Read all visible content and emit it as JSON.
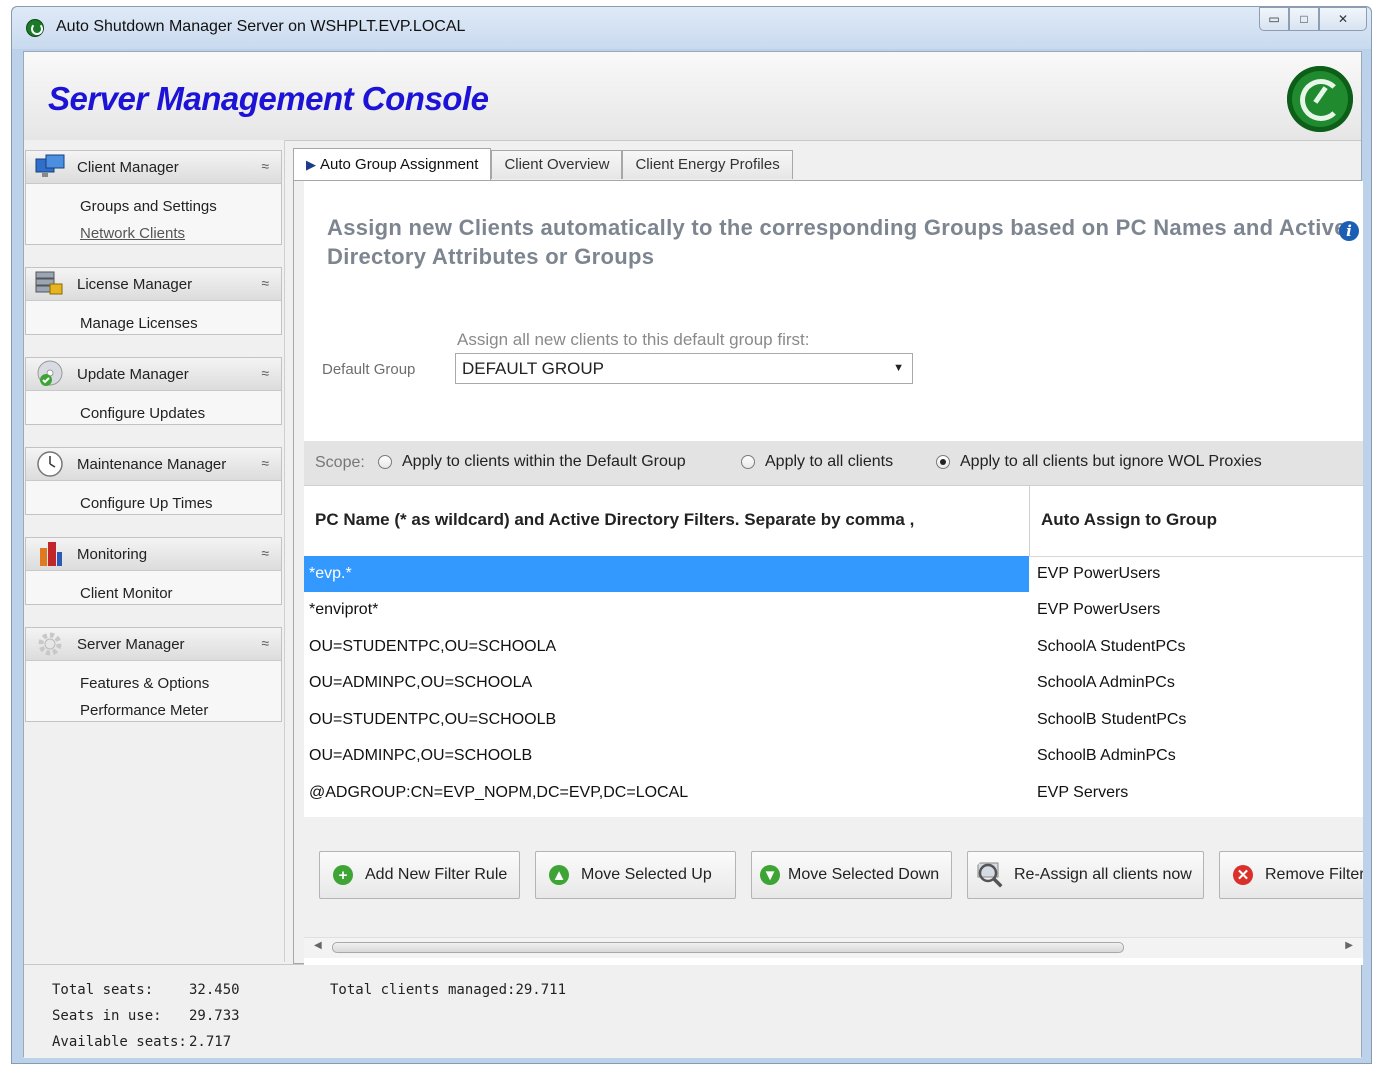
{
  "window": {
    "title": "Auto Shutdown Manager Server on WSHPLT.EVP.LOCAL",
    "minimize_glyph": "▭",
    "maximize_glyph": "□",
    "close_glyph": "✕"
  },
  "header": {
    "title": "Server Management Console",
    "logo_icon": "power-clock-icon"
  },
  "sidebar": {
    "sections": [
      {
        "title": "Client Manager",
        "icon": "monitors-icon",
        "items": [
          "Groups and Settings",
          "Network Clients"
        ]
      },
      {
        "title": "License Manager",
        "icon": "license-server-icon",
        "items": [
          "Manage Licenses"
        ]
      },
      {
        "title": "Update  Manager",
        "icon": "update-disc-icon",
        "items": [
          "Configure Updates"
        ]
      },
      {
        "title": "Maintenance Manager",
        "icon": "clock-icon",
        "items": [
          "Configure Up Times"
        ]
      },
      {
        "title": "Monitoring",
        "icon": "bar-chart-icon",
        "items": [
          "Client Monitor"
        ]
      },
      {
        "title": "Server Manager",
        "icon": "gear-icon",
        "items": [
          "Features & Options",
          "Performance Meter"
        ]
      }
    ],
    "collapse_glyph": "≈"
  },
  "tabs": [
    {
      "label": "Auto Group Assignment",
      "active": true
    },
    {
      "label": "Client Overview",
      "active": false
    },
    {
      "label": "Client Energy Profiles",
      "active": false
    }
  ],
  "panel": {
    "headline": "Assign new Clients automatically to the corresponding Groups based on PC Names and Active Directory Attributes or Groups",
    "info_icon": "i",
    "assign_label": "Assign all new clients to this default group first:",
    "default_group_label": "Default Group",
    "default_group_value": "DEFAULT GROUP",
    "scope": {
      "label": "Scope:",
      "options": [
        {
          "label": "Apply to clients within the Default Group",
          "checked": false
        },
        {
          "label": "Apply to all clients",
          "checked": false
        },
        {
          "label": "Apply to all clients but  ignore WOL Proxies",
          "checked": true
        }
      ]
    },
    "grid": {
      "columns": [
        "PC Name (* as wildcard) and Active Directory Filters. Separate by comma ,",
        "Auto Assign to Group"
      ],
      "rows": [
        {
          "filter": "*evp.*",
          "group": "EVP PowerUsers",
          "selected": true
        },
        {
          "filter": "*enviprot*",
          "group": "EVP PowerUsers",
          "selected": false
        },
        {
          "filter": "OU=STUDENTPC,OU=SCHOOLA",
          "group": "SchoolA StudentPCs",
          "selected": false
        },
        {
          "filter": "OU=ADMINPC,OU=SCHOOLA",
          "group": "SchoolA AdminPCs",
          "selected": false
        },
        {
          "filter": "OU=STUDENTPC,OU=SCHOOLB",
          "group": "SchoolB StudentPCs",
          "selected": false
        },
        {
          "filter": "OU=ADMINPC,OU=SCHOOLB",
          "group": "SchoolB AdminPCs",
          "selected": false
        },
        {
          "filter": "@ADGROUP:CN=EVP_NOPM,DC=EVP,DC=LOCAL",
          "group": "EVP Servers",
          "selected": false
        }
      ]
    },
    "buttons": {
      "add": "Add New Filter Rule",
      "up": "Move Selected Up",
      "down": "Move Selected Down",
      "reassign": "Re-Assign all clients now",
      "remove": "Remove Filter"
    }
  },
  "footer": {
    "total_seats_label": "Total seats:",
    "total_seats": "32.450",
    "seats_in_use_label": "Seats in use:",
    "seats_in_use": "29.733",
    "available_seats_label": "Available seats:",
    "available_seats": "2.717",
    "total_clients_label": "Total clients managed:",
    "total_clients": "29.711"
  },
  "colors": {
    "header_title": "#1d13d6",
    "selection": "#3399ff",
    "brand_green": "#1f8a2e"
  }
}
